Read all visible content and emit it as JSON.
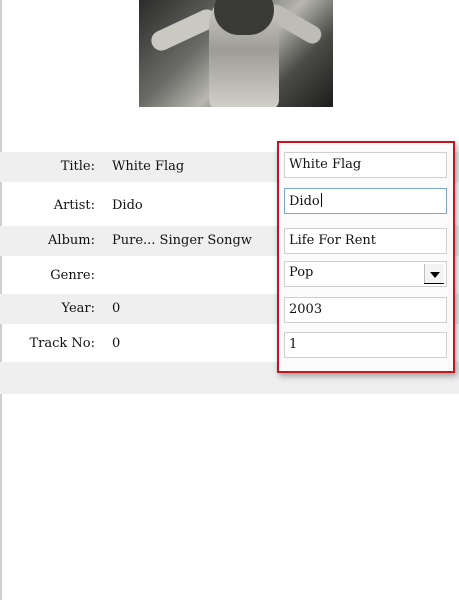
{
  "labels": {
    "title": "Title:",
    "artist": "Artist:",
    "album": "Album:",
    "genre": "Genre:",
    "year": "Year:",
    "track": "Track No:"
  },
  "current": {
    "title": "White Flag",
    "artist": "Dido",
    "album": "Pure... Singer Songw",
    "genre": "",
    "year": "0",
    "track": "0"
  },
  "edit": {
    "title": "White Flag",
    "artist": "Dido",
    "album": "Life For Rent",
    "genre": "Pop",
    "year": "2003",
    "track": "1"
  },
  "colors": {
    "highlight_border": "#c4161c",
    "row_shade": "#efefef"
  }
}
